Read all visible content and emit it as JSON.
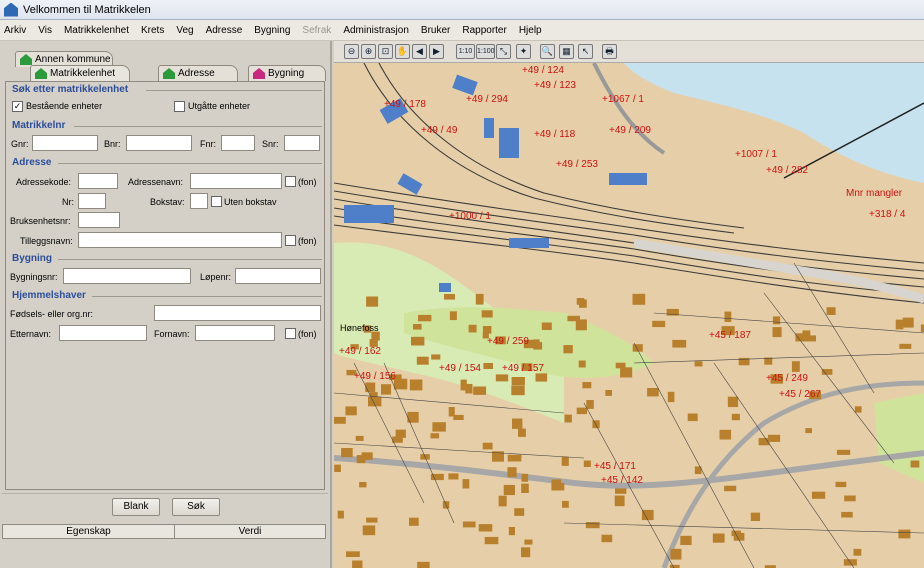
{
  "app": {
    "title": "Velkommen til Matrikkelen"
  },
  "menu": [
    "Arkiv",
    "Vis",
    "Matrikkelenhet",
    "Krets",
    "Veg",
    "Adresse",
    "Bygning",
    "Sefrak",
    "Administrasjon",
    "Bruker",
    "Rapporter",
    "Hjelp"
  ],
  "menu_disabled": "Sefrak",
  "tabs": {
    "annen_kommune": "Annen kommune",
    "matrikkelenhet": "Matrikkelenhet",
    "adresse": "Adresse",
    "bygning": "Bygning"
  },
  "form": {
    "title": "Søk etter matrikkelenhet",
    "bestaende": "Bestående enheter",
    "utgatte": "Utgåtte enheter",
    "matrikkelnr": "Matrikkelnr",
    "gnr": "Gnr:",
    "bnr": "Bnr:",
    "fnr": "Fnr:",
    "snr": "Snr:",
    "adresse": "Adresse",
    "adressekode": "Adressekode:",
    "adressenavn": "Adressenavn:",
    "fon": "(fon)",
    "nr": "Nr:",
    "bokstav": "Bokstav:",
    "uten_bokstav": "Uten bokstav",
    "bruksenhetsnr": "Bruksenhetsnr:",
    "tilleggsnavn": "Tilleggsnavn:",
    "bygning": "Bygning",
    "bygningsnr": "Bygningsnr:",
    "lopenr": "Løpenr:",
    "hjemmelshaver": "Hjemmelshaver",
    "fodsels": "Fødsels- eller org.nr:",
    "etternavn": "Etternavn:",
    "fornavn": "Fornavn:"
  },
  "buttons": {
    "blank": "Blank",
    "sok": "Søk"
  },
  "props": {
    "egenskap": "Egenskap",
    "verdi": "Verdi"
  },
  "toolbar_icons": [
    "zoom-out-icon",
    "zoom-in-icon",
    "zoom-rect-icon",
    "pan-icon",
    "prev-view-icon",
    "next-view-icon",
    "scale-1-10-icon",
    "scale-1-100-icon",
    "zoom-extent-icon",
    "zoom-layer-icon",
    "search-icon",
    "layer-icon",
    "select-icon",
    "print-icon"
  ],
  "toolbar_glyphs": [
    "⊖",
    "⊕",
    "⊡",
    "✋",
    "◀",
    "▶",
    "1:10",
    "1:100",
    "⤡",
    "✦",
    "🔍",
    "▦",
    "↖",
    "🖶"
  ],
  "map": {
    "place_name": "Hønefoss",
    "mnr": "Mnr mangler",
    "labels": [
      "+49 / 124",
      "+49 / 123",
      "+1067 / 1",
      "+49 / 178",
      "+49 / 294",
      "+49 / 118",
      "+49 / 49",
      "+49 / 209",
      "+49 / 253",
      "+1007 / 1",
      "+49 / 282",
      "+1000 / 1",
      "+49 / 259",
      "+49 / 157",
      "+45 / 249",
      "+45 / 171",
      "+45 / 142",
      "+45 / 267",
      "+49 / 154",
      "+49 / 162",
      "+49 / 156",
      "+45 / 187",
      "+318 / 4"
    ]
  }
}
